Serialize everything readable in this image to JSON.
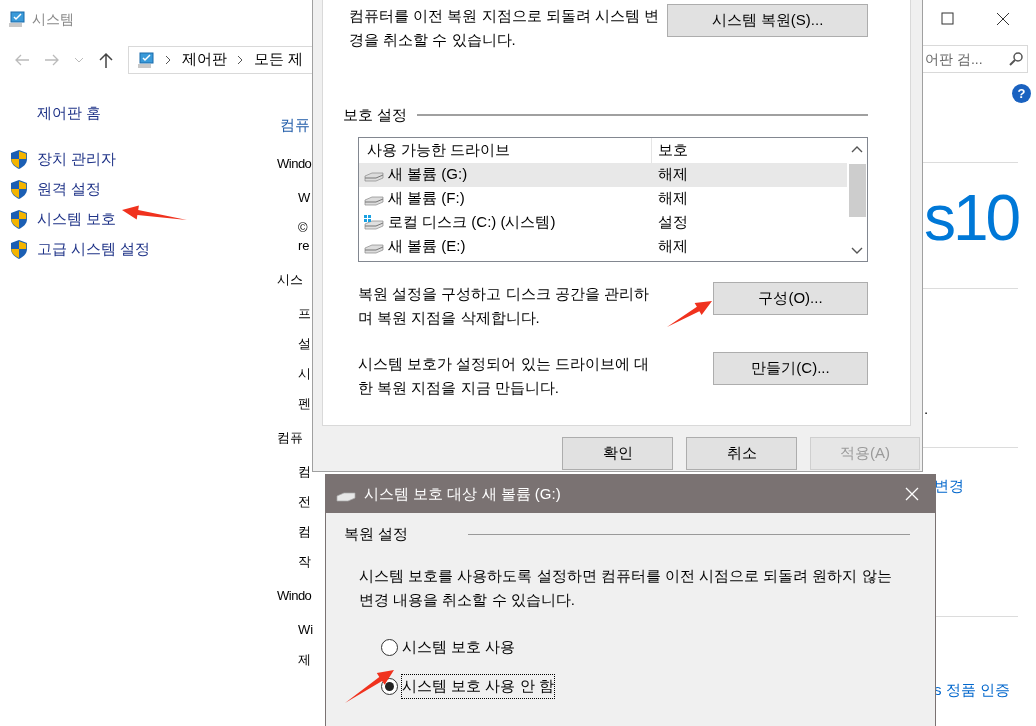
{
  "window": {
    "title": "시스템"
  },
  "address_bar": {
    "path": [
      "제어판",
      "모든 제"
    ]
  },
  "search": {
    "placeholder": "어판 검..."
  },
  "help": "?",
  "sidebar": {
    "home": "제어판 홈",
    "items": [
      {
        "label": "장치 관리자"
      },
      {
        "label": "원격 설정"
      },
      {
        "label": "시스템 보호"
      },
      {
        "label": "고급 시스템 설정"
      }
    ]
  },
  "main": {
    "items": [
      {
        "kind": "heading",
        "text": "컴퓨"
      },
      {
        "kind": "section",
        "text": "Windo"
      },
      {
        "kind": "item",
        "text": "W"
      },
      {
        "kind": "item",
        "text": "©"
      },
      {
        "kind": "cont",
        "text": "re"
      },
      {
        "kind": "section",
        "text": "시스"
      },
      {
        "kind": "item",
        "text": "프"
      },
      {
        "kind": "item",
        "text": "설"
      },
      {
        "kind": "item",
        "text": "시"
      },
      {
        "kind": "item",
        "text": "펜"
      },
      {
        "kind": "section",
        "text": "컴퓨"
      },
      {
        "kind": "item",
        "text": "컴"
      },
      {
        "kind": "item",
        "text": "전"
      },
      {
        "kind": "item",
        "text": "컴"
      },
      {
        "kind": "item",
        "text": "작"
      },
      {
        "kind": "section",
        "text": "Windo"
      },
      {
        "kind": "item",
        "text": "Wi"
      },
      {
        "kind": "item",
        "text": "제"
      }
    ]
  },
  "right_fragments": {
    "logo": "s10",
    "period": ".",
    "change_link": "변경",
    "activation_link": "s 정품 인증"
  },
  "properties_dialog": {
    "restore_text": "컴퓨터를 이전 복원 지점으로 되돌려 시스템 변경을 취소할 수 있습니다.",
    "restore_button": "시스템 복원(S)...",
    "group": "보호 설정",
    "columns": [
      "사용 가능한 드라이브",
      "보호"
    ],
    "drives": [
      {
        "kind": "volume",
        "name": "새 볼륨 (G:)",
        "protection": "해제",
        "selected": true
      },
      {
        "kind": "volume",
        "name": "새 볼륨 (F:)",
        "protection": "해제",
        "selected": false
      },
      {
        "kind": "system",
        "name": "로컬 디스크 (C:) (시스템)",
        "protection": "설정",
        "selected": false
      },
      {
        "kind": "volume",
        "name": "새 볼륨 (E:)",
        "protection": "해제",
        "selected": false
      }
    ],
    "configure_text": "복원 설정을 구성하고 디스크 공간을 관리하며 복원 지점을 삭제합니다.",
    "configure_button": "구성(O)...",
    "create_text": "시스템 보호가 설정되어 있는 드라이브에 대한 복원 지점을 지금 만듭니다.",
    "create_button": "만들기(C)...",
    "buttons": [
      {
        "label": "확인",
        "disabled": false
      },
      {
        "label": "취소",
        "disabled": false
      },
      {
        "label": "적용(A)",
        "disabled": true
      }
    ]
  },
  "volume_dialog": {
    "title": "시스템 보호 대상 새 볼륨 (G:)",
    "group": "복원 설정",
    "description": "시스템 보호를 사용하도록 설정하면 컴퓨터를 이전 시점으로 되돌려 원하지 않는 변경 내용을 취소할 수 있습니다.",
    "options": [
      {
        "label": "시스템 보호 사용",
        "selected": false
      },
      {
        "label": "시스템 보호 사용 안 함",
        "selected": true
      }
    ]
  }
}
